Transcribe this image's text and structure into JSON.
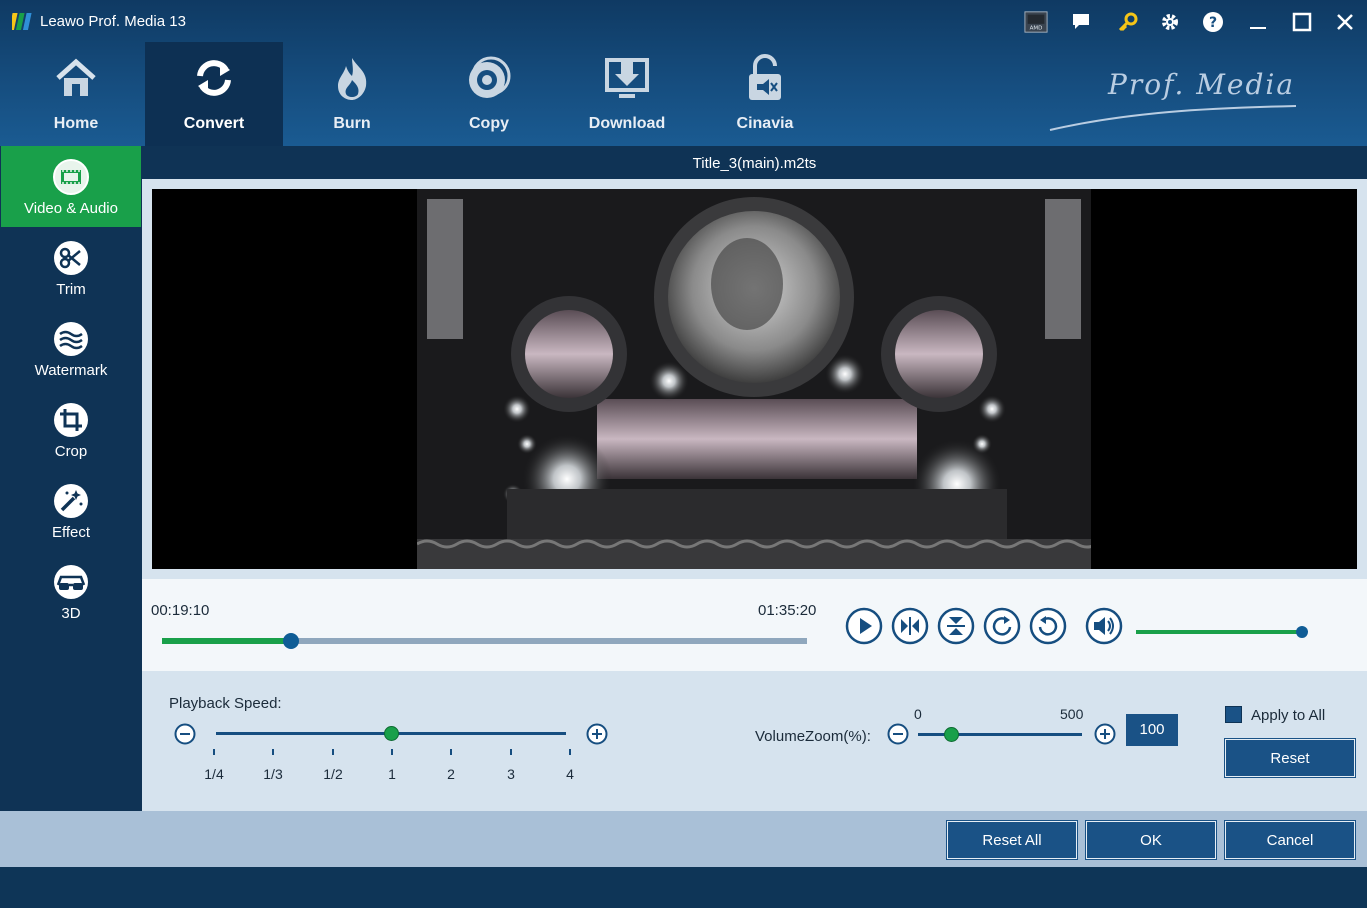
{
  "window": {
    "title": "Leawo Prof. Media 13",
    "icons": [
      "amd-badge-icon",
      "feedback-icon",
      "key-icon",
      "settings-gear-icon",
      "help-icon",
      "minimize-icon",
      "maximize-icon",
      "close-icon"
    ]
  },
  "nav": {
    "items": [
      {
        "label": "Home",
        "icon": "home-icon"
      },
      {
        "label": "Convert",
        "icon": "convert-icon",
        "active": true
      },
      {
        "label": "Burn",
        "icon": "burn-icon"
      },
      {
        "label": "Copy",
        "icon": "copy-disc-icon"
      },
      {
        "label": "Download",
        "icon": "download-icon"
      },
      {
        "label": "Cinavia",
        "icon": "cinavia-lock-icon"
      }
    ],
    "brand": "Prof. Media"
  },
  "sidebar": {
    "items": [
      {
        "label": "Video & Audio",
        "icon": "film-icon",
        "active": true
      },
      {
        "label": "Trim",
        "icon": "scissors-icon"
      },
      {
        "label": "Watermark",
        "icon": "watermark-icon"
      },
      {
        "label": "Crop",
        "icon": "crop-icon"
      },
      {
        "label": "Effect",
        "icon": "magic-wand-icon"
      },
      {
        "label": "3D",
        "icon": "3d-glasses-icon"
      }
    ]
  },
  "video": {
    "file_title": "Title_3(main).m2ts"
  },
  "player": {
    "current_time": "00:19:10",
    "total_time": "01:35:20",
    "progress": 0.2,
    "volume": 1.0,
    "buttons": [
      "play-icon",
      "frame-step-icon",
      "flip-vertical-icon",
      "rotate-clockwise-icon",
      "rotate-counterclockwise-icon",
      "volume-icon"
    ]
  },
  "settings": {
    "playback_speed_label": "Playback Speed:",
    "speed_ticks": [
      "1/4",
      "1/3",
      "1/2",
      "1",
      "2",
      "3",
      "4"
    ],
    "speed_selected_index": 3,
    "volume_zoom_label": "VolumeZoom(%):",
    "volume_zoom_min": "0",
    "volume_zoom_max": "500",
    "volume_zoom_value": "100",
    "apply_to_all_label": "Apply to All",
    "apply_to_all_checked": true,
    "reset_label": "Reset"
  },
  "footer": {
    "reset_all_label": "Reset All",
    "ok_label": "OK",
    "cancel_label": "Cancel"
  },
  "colors": {
    "accent_green": "#19a04a",
    "nav_blue": "#164e80",
    "button_blue": "#1a5286"
  }
}
